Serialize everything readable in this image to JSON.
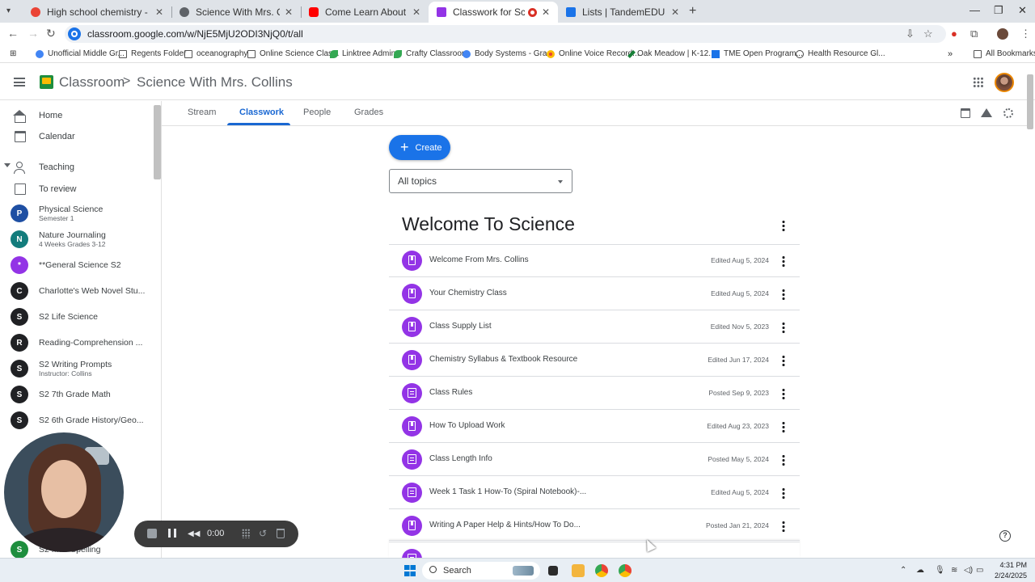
{
  "browser": {
    "tabs": [
      {
        "title": "High school chemistry - science",
        "color": "#ea4335"
      },
      {
        "title": "Science With Mrs. Collins",
        "color": "#5f6368"
      },
      {
        "title": "Come Learn About Science Wit",
        "color": "#ff0000"
      },
      {
        "title": "Classwork for Science With",
        "color": "#9334e6"
      },
      {
        "title": "Lists | TandemEDU",
        "color": "#1a73e8"
      }
    ],
    "url": "classroom.google.com/w/NjE5MjU2ODI3NjQ0/t/all",
    "bookmarks": [
      {
        "label": "Unofficial Middle Gr...",
        "icon": "drop"
      },
      {
        "label": "Regents Folder",
        "icon": "folder"
      },
      {
        "label": "oceanography",
        "icon": "folder"
      },
      {
        "label": "Online Science Clas...",
        "icon": "folder"
      },
      {
        "label": "Linktree Admin",
        "icon": "leaf"
      },
      {
        "label": "Crafty Classroom",
        "icon": "leaf"
      },
      {
        "label": "Body Systems - Gra...",
        "icon": "drop"
      },
      {
        "label": "Online Voice Record...",
        "icon": "dots"
      },
      {
        "label": "Oak Meadow | K-12...",
        "icon": "pen"
      },
      {
        "label": "TME Open Program...",
        "icon": "doc"
      },
      {
        "label": "Health Resource Gl...",
        "icon": "globe"
      }
    ],
    "all_bookmarks": "All Bookmarks"
  },
  "header": {
    "app_title": "Classroom",
    "separator": ">",
    "class_name": "Science With Mrs. Collins"
  },
  "sidebar": {
    "home": "Home",
    "calendar": "Calendar",
    "teaching": "Teaching",
    "to_review": "To review",
    "courses": [
      {
        "initial": "P",
        "name": "Physical Science",
        "sub": "Semester 1",
        "color": "#1e4fa3"
      },
      {
        "initial": "N",
        "name": "Nature Journaling",
        "sub": "4 Weeks Grades 3-12",
        "color": "#137c7c"
      },
      {
        "initial": "*",
        "name": "**General Science S2",
        "sub": "",
        "color": "#9334e6"
      },
      {
        "initial": "C",
        "name": "Charlotte's Web Novel Stu...",
        "sub": "",
        "color": "#202124"
      },
      {
        "initial": "S",
        "name": "S2 Life Science",
        "sub": "",
        "color": "#202124"
      },
      {
        "initial": "R",
        "name": "Reading-Comprehension ...",
        "sub": "",
        "color": "#202124"
      },
      {
        "initial": "S",
        "name": "S2 Writing Prompts",
        "sub": "Instructor: Collins",
        "color": "#202124"
      },
      {
        "initial": "S",
        "name": "S2 7th Grade Math",
        "sub": "",
        "color": "#202124"
      },
      {
        "initial": "S",
        "name": "S2 6th Grade History/Geo...",
        "sub": "",
        "color": "#202124"
      },
      {
        "initial": "S",
        "name": "S2 ...de Spelling",
        "sub": "",
        "color": "#1e8e3e"
      }
    ]
  },
  "tabs": {
    "stream": "Stream",
    "classwork": "Classwork",
    "people": "People",
    "grades": "Grades"
  },
  "main": {
    "create_label": "Create",
    "topic_filter": "All topics",
    "section_title": "Welcome To Science",
    "items": [
      {
        "title": "Welcome From Mrs. Collins",
        "status": "Edited Aug 5, 2024",
        "icon": "book"
      },
      {
        "title": "Your Chemistry Class",
        "status": "Edited Aug 5, 2024",
        "icon": "book"
      },
      {
        "title": "Class Supply List",
        "status": "Edited Nov 5, 2023",
        "icon": "book"
      },
      {
        "title": "Chemistry Syllabus & Textbook Resource",
        "status": "Edited Jun 17, 2024",
        "icon": "book"
      },
      {
        "title": "Class Rules",
        "status": "Posted Sep 9, 2023",
        "icon": "note"
      },
      {
        "title": "How To Upload Work",
        "status": "Edited Aug 23, 2023",
        "icon": "book"
      },
      {
        "title": "Class Length Info",
        "status": "Posted May 5, 2024",
        "icon": "note"
      },
      {
        "title": "Week 1 Task 1 How-To (Spiral Notebook)-...",
        "status": "Edited Aug 5, 2024",
        "icon": "note"
      },
      {
        "title": "Writing A Paper Help & Hints/How To Do...",
        "status": "Posted Jan 21, 2024",
        "icon": "book"
      }
    ]
  },
  "recorder": {
    "time": "0:00"
  },
  "taskbar": {
    "search_label": "Search",
    "time": "4:31 PM",
    "date": "2/24/2025"
  }
}
